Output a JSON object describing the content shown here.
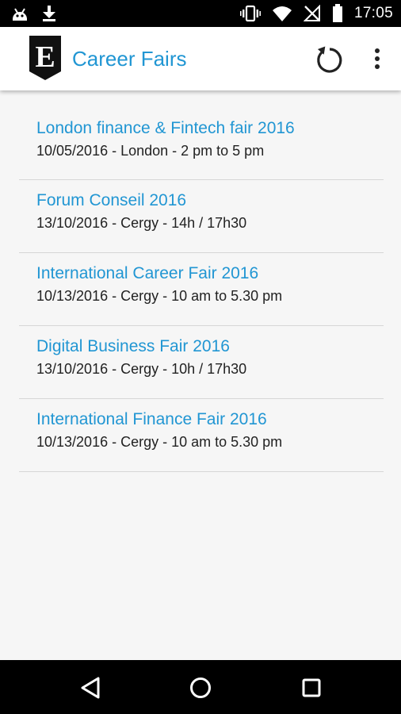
{
  "status_bar": {
    "time": "17:05",
    "left_icons": [
      "android-debug-icon",
      "download-icon"
    ],
    "right_icons": [
      "vibrate-icon",
      "wifi-icon",
      "no-signal-icon",
      "battery-icon"
    ]
  },
  "app_bar": {
    "title": "Career Fairs",
    "logo_letter": "E",
    "actions": [
      "refresh-icon",
      "overflow-menu-icon"
    ]
  },
  "fairs": [
    {
      "title": "London finance & Fintech fair 2016",
      "details": "10/05/2016 - London - 2 pm to 5 pm"
    },
    {
      "title": "Forum Conseil 2016",
      "details": "13/10/2016 - Cergy - 14h / 17h30"
    },
    {
      "title": "International Career Fair 2016",
      "details": "10/13/2016 - Cergy - 10 am to 5.30 pm"
    },
    {
      "title": "Digital Business Fair 2016",
      "details": "13/10/2016 - Cergy - 10h / 17h30"
    },
    {
      "title": "International Finance Fair 2016",
      "details": "10/13/2016 - Cergy - 10 am to 5.30 pm"
    }
  ],
  "nav_bar": {
    "buttons": [
      "back-icon",
      "home-icon",
      "recents-icon"
    ]
  },
  "colors": {
    "accent": "#2196d3",
    "text": "#222222",
    "background": "#f6f6f6",
    "divider": "#d6d6d6",
    "system_bars": "#000000"
  }
}
